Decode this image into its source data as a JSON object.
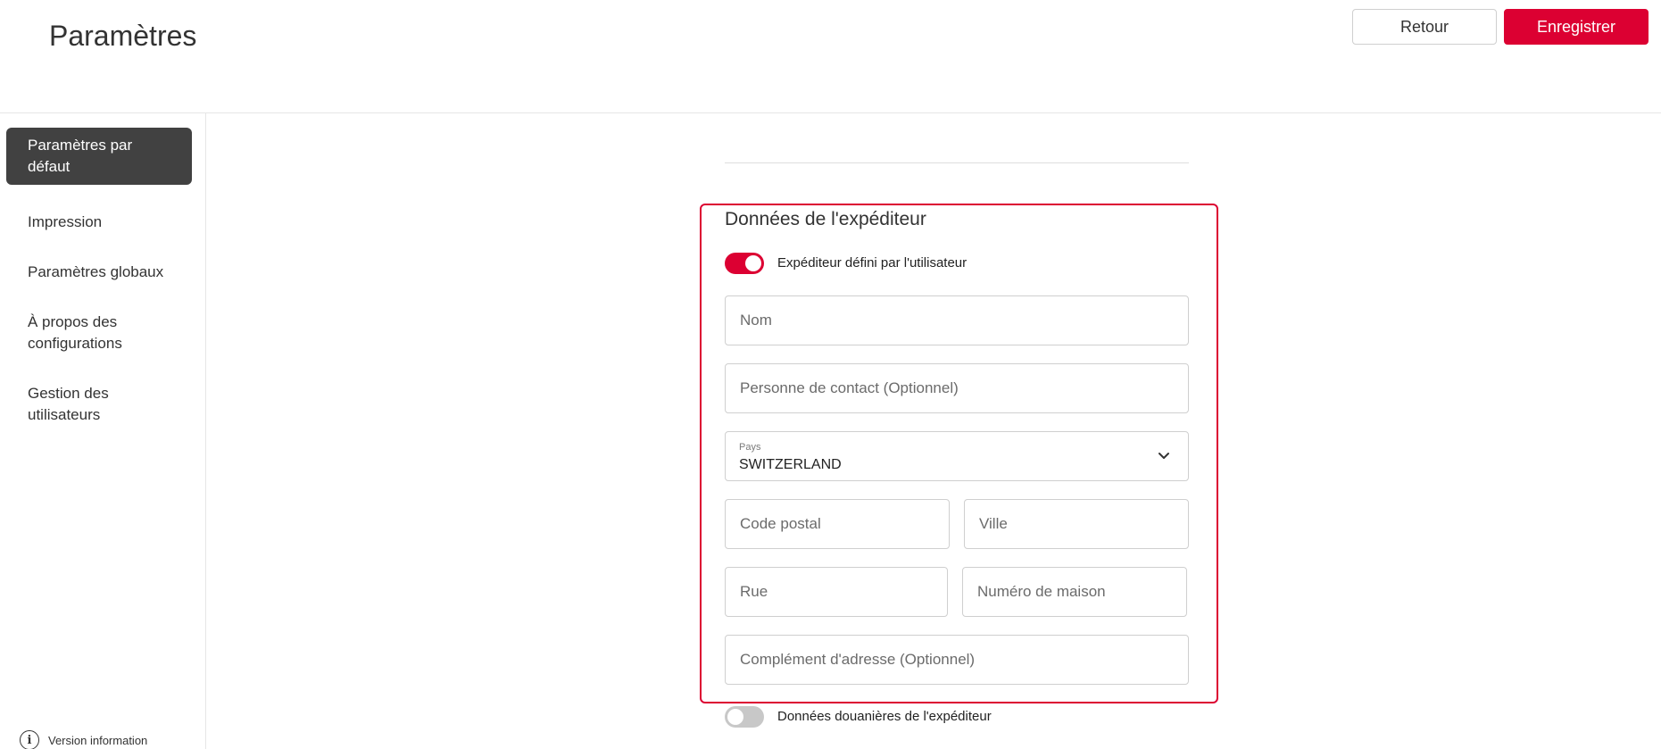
{
  "header": {
    "title": "Paramètres",
    "back_label": "Retour",
    "save_label": "Enregistrer"
  },
  "sidebar": {
    "items": [
      {
        "label": "Paramètres par défaut",
        "active": true
      },
      {
        "label": "Impression",
        "active": false
      },
      {
        "label": "Paramètres globaux",
        "active": false
      },
      {
        "label": "À propos des configurations",
        "active": false
      },
      {
        "label": "Gestion des utilisateurs",
        "active": false
      }
    ],
    "version_label": "Version information",
    "version_icon": "info-icon"
  },
  "sender": {
    "section_title": "Données de l'expéditeur",
    "user_defined_toggle": {
      "label": "Expéditeur défini par l'utilisateur",
      "on": true
    },
    "fields": {
      "name": {
        "placeholder": "Nom",
        "value": ""
      },
      "contact": {
        "placeholder": "Personne de contact (Optionnel)",
        "value": ""
      },
      "country": {
        "label": "Pays",
        "value": "SWITZERLAND"
      },
      "postal_code": {
        "placeholder": "Code postal",
        "value": ""
      },
      "city": {
        "placeholder": "Ville",
        "value": ""
      },
      "street": {
        "placeholder": "Rue",
        "value": ""
      },
      "house_number": {
        "placeholder": "Numéro de maison",
        "value": ""
      },
      "address_complement": {
        "placeholder": "Complément d'adresse (Optionnel)",
        "value": ""
      }
    },
    "customs_toggle": {
      "label": "Données douanières de l'expéditeur",
      "on": false
    }
  },
  "colors": {
    "accent": "#dc0032",
    "active_nav": "#414141",
    "toggle_off": "#c8c8c8"
  }
}
